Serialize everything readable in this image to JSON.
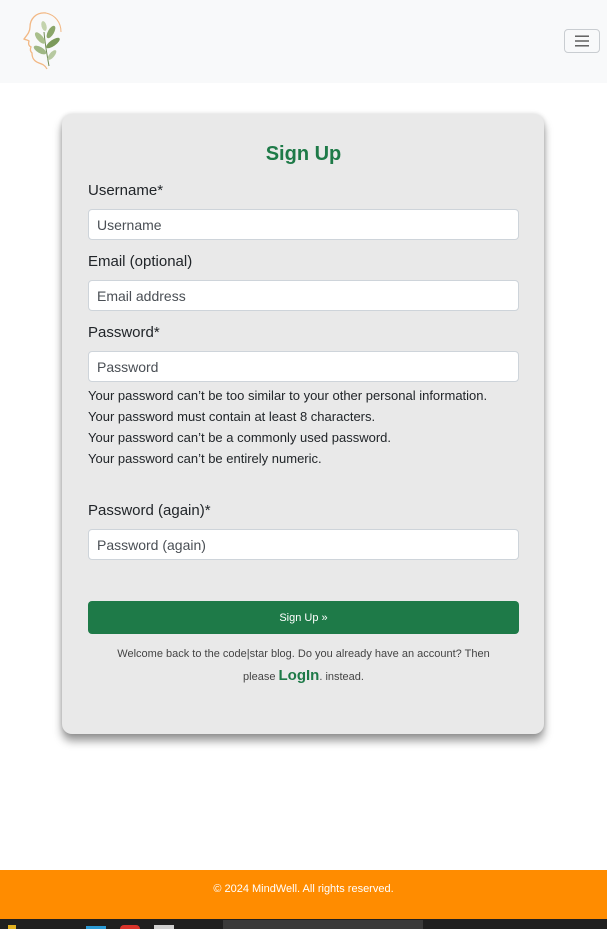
{
  "form": {
    "title": "Sign Up",
    "username": {
      "label": "Username*",
      "placeholder": "Username",
      "value": ""
    },
    "email": {
      "label": "Email (optional)",
      "placeholder": "Email address",
      "value": ""
    },
    "password": {
      "label": "Password*",
      "placeholder": "Password",
      "value": "",
      "help": [
        "Your password can’t be too similar to your other personal information.",
        "Your password must contain at least 8 characters.",
        "Your password can’t be a commonly used password.",
        "Your password can’t be entirely numeric."
      ]
    },
    "password2": {
      "label": "Password (again)*",
      "placeholder": "Password (again)",
      "value": ""
    },
    "submit_label": "Sign Up »",
    "login_prefix": "Welcome back to the code|star blog. Do you already have an account? Then please ",
    "login_link": "LogIn",
    "login_suffix": ". instead."
  },
  "footer": {
    "text": "© 2024 MindWell. All rights reserved."
  },
  "icons": {
    "brand": "leaf-face-logo-icon",
    "toggler": "hamburger-menu-icon"
  },
  "colors": {
    "accent": "#1e7a48",
    "footer": "#ff8c00",
    "card": "#e9e9e9",
    "navbar": "#f8f9fa"
  }
}
